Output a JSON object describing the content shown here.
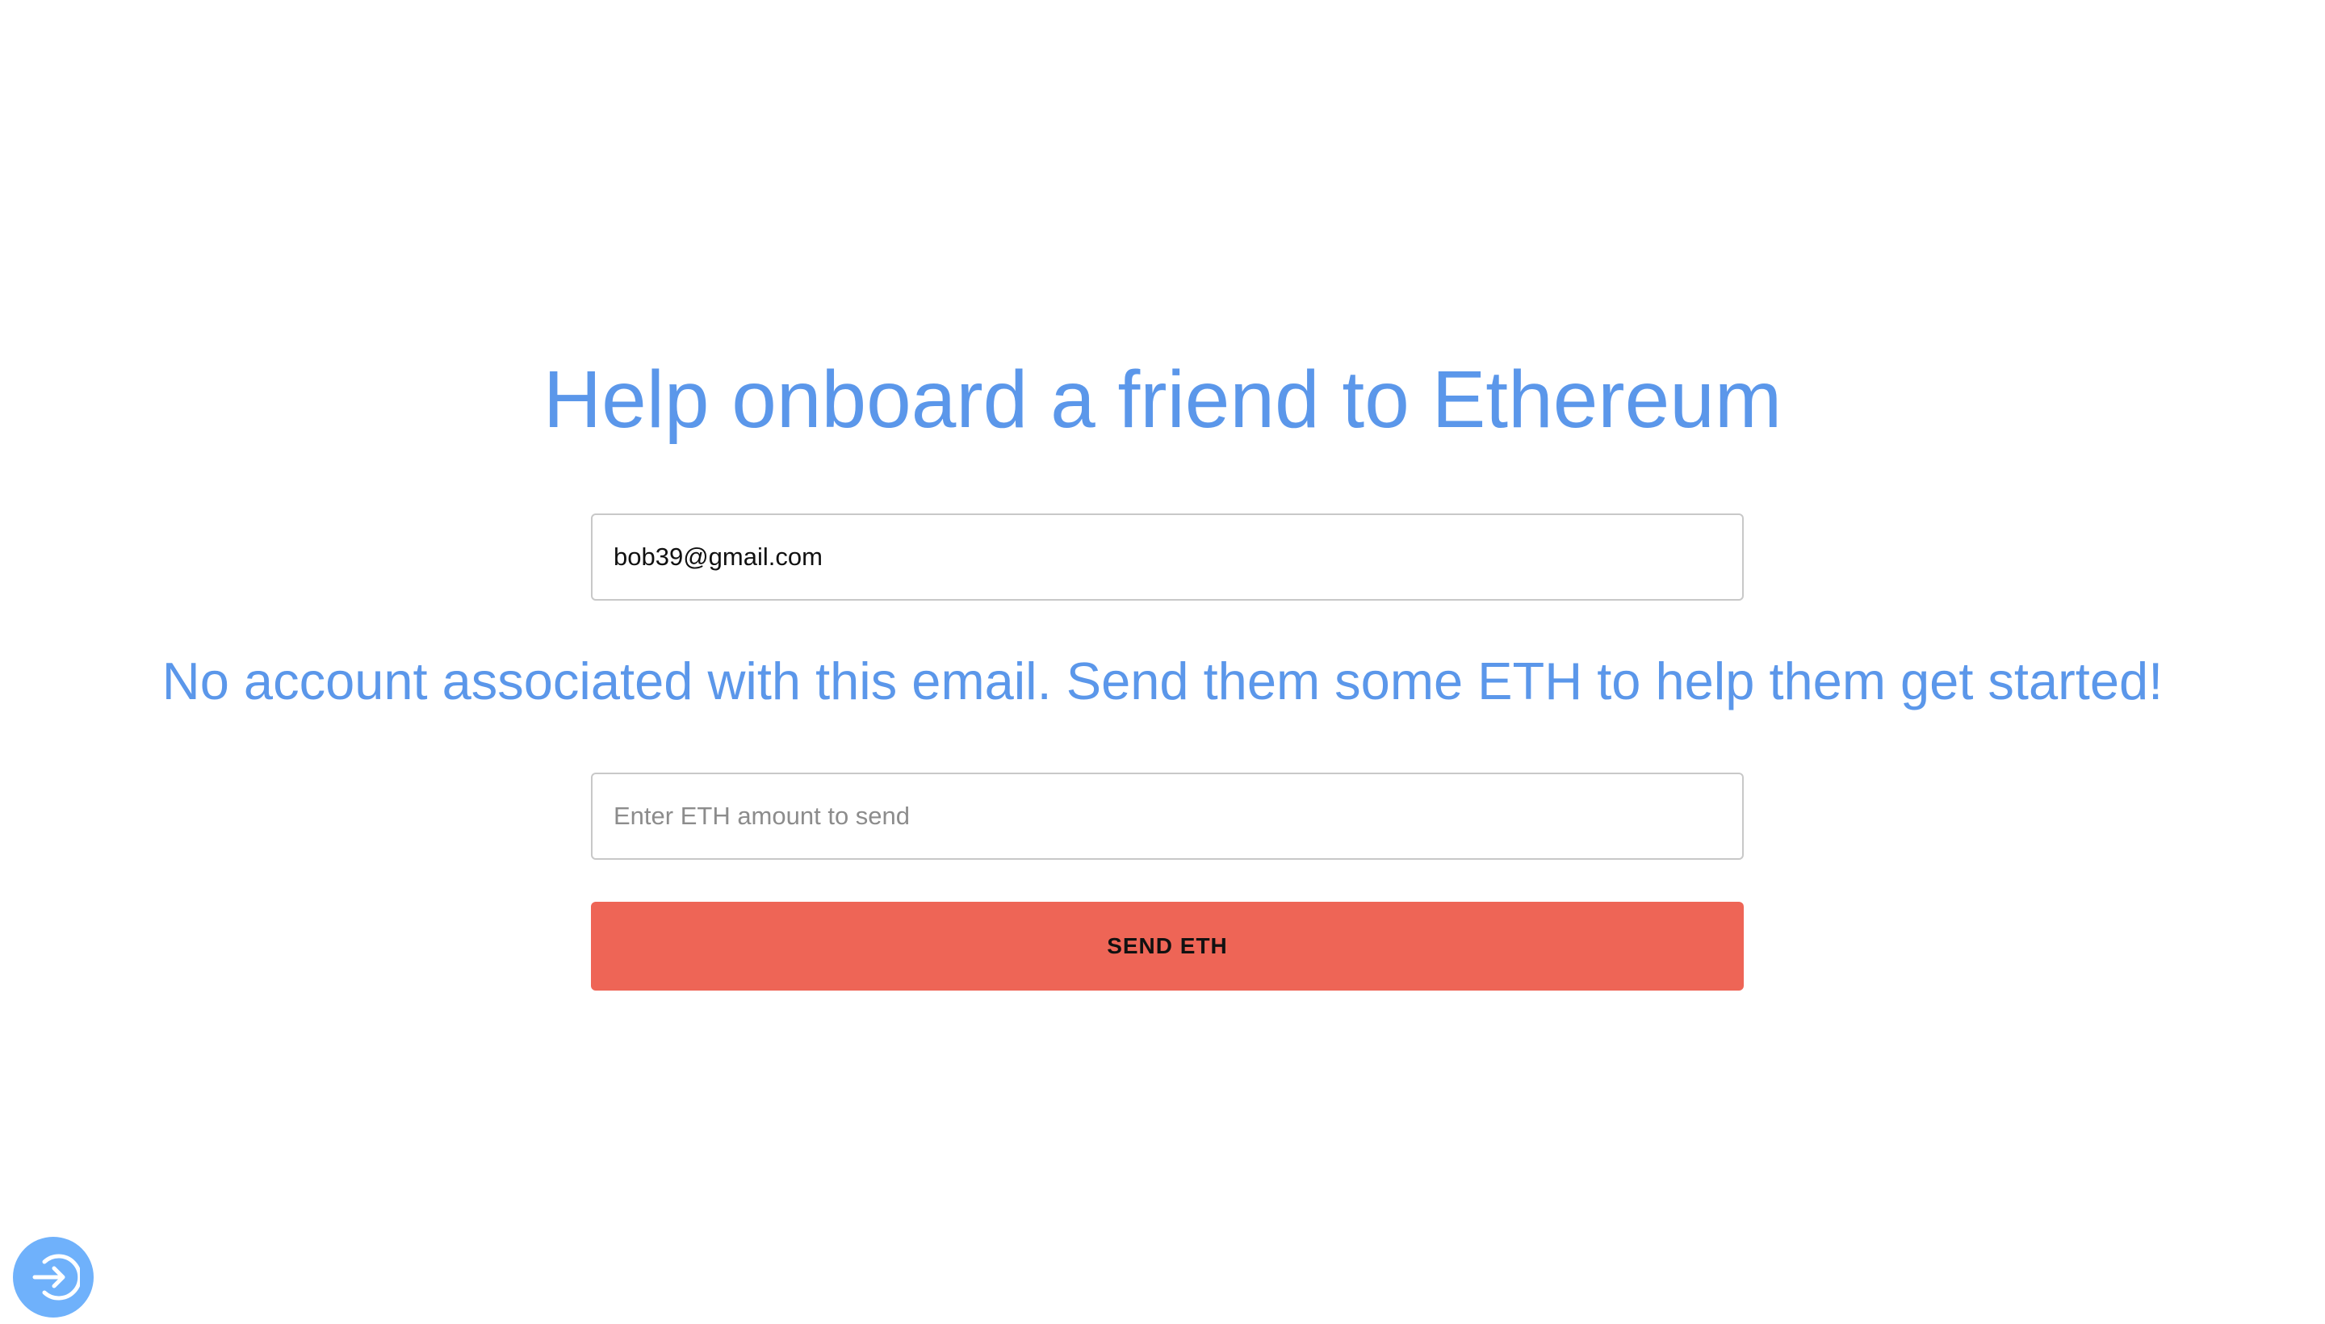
{
  "header": {
    "title": "Help onboard a friend to Ethereum"
  },
  "form": {
    "email_value": "bob39@gmail.com",
    "message": "No account associated with this email. Send them some ETH to help them get started!",
    "amount_placeholder": "Enter ETH amount to send",
    "amount_value": "",
    "send_label": "SEND ETH"
  },
  "fab": {
    "icon": "login-arrow-icon"
  },
  "colors": {
    "accent": "#5b97ea",
    "button": "#ee6556",
    "fab": "#6fb1fb"
  }
}
